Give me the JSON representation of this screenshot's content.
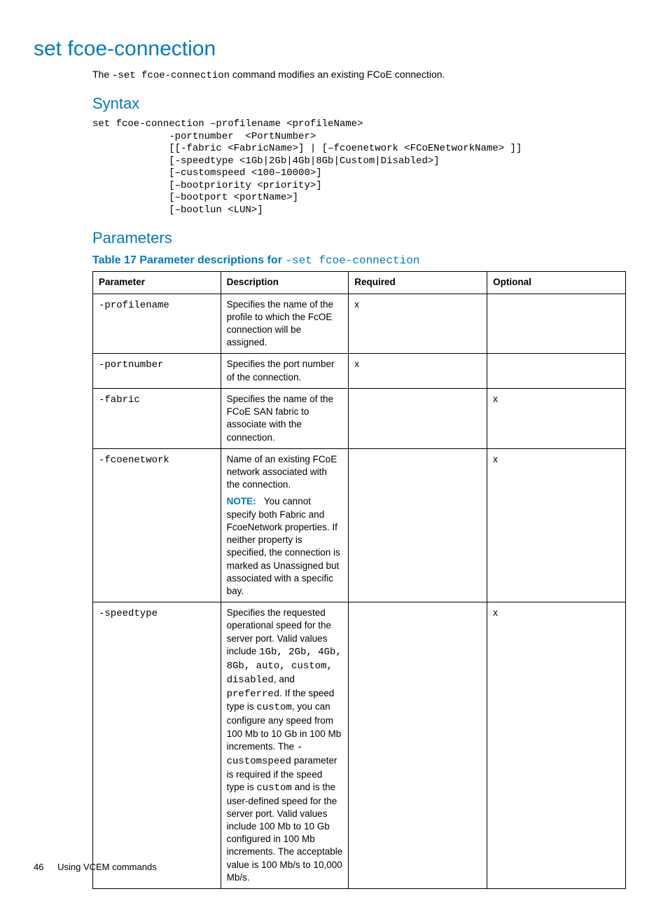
{
  "title": "set fcoe-connection",
  "intro_pre": "The ",
  "intro_code": "-set fcoe-connection",
  "intro_post": " command modifies an existing FCoE connection.",
  "syntax_heading": "Syntax",
  "syntax_block": "set fcoe-connection –profilename <profileName>\n             -portnumber  <PortNumber>\n             [[-fabric <FabricName>] | [–fcoenetwork <FCoENetworkName> ]]\n             [-speedtype <1Gb|2Gb|4Gb|8Gb|Custom|Disabled>]\n             [–customspeed <100–10000>]\n             [–bootpriority <priority>]\n             [–bootport <portName>]\n             [–bootlun <LUN>]",
  "parameters_heading": "Parameters",
  "table_caption_prefix": "Table 17 Parameter descriptions for ",
  "table_caption_code": "-set fcoe-connection",
  "headers": {
    "parameter": "Parameter",
    "description": "Description",
    "required": "Required",
    "optional": "Optional"
  },
  "rows": {
    "profilename": {
      "param": "-profilename",
      "desc": "Specifies the name of the profile to which the FcOE connection will be assigned.",
      "required": "x",
      "optional": ""
    },
    "portnumber": {
      "param": "-portnumber",
      "desc": "Specifies the port number of the connection.",
      "required": "x",
      "optional": ""
    },
    "fabric": {
      "param": "-fabric",
      "desc": "Specifies the name of the FCoE SAN fabric to associate with the connection.",
      "required": "",
      "optional": "x"
    },
    "fcoenetwork": {
      "param": "-fcoenetwork",
      "desc1": "Name of an existing FCoE network associated with the connection.",
      "note_label": "NOTE:",
      "note_text": "You cannot specify both Fabric and FcoeNetwork properties. If neither property is specified, the connection is marked as Unassigned but associated with a specific bay.",
      "required": "",
      "optional": "x"
    },
    "speedtype": {
      "param": "-speedtype",
      "d_a": "Specifies the requested operational speed for the server port. Valid values include ",
      "d_vals": "1Gb, 2Gb, 4Gb, 8Gb, auto, custom, disabled",
      "d_b": ", and ",
      "d_pref": "preferred",
      "d_c": ". If the speed type is ",
      "d_custom1": "custom",
      "d_d": ", you can configure any speed from 100 Mb to 10 Gb in 100 Mb increments. The ",
      "d_cs": "-customspeed",
      "d_e": " parameter is required if the speed type is ",
      "d_custom2": "custom",
      "d_f": " and is the user-defined speed for the server port. Valid values include 100 Mb to 10 Gb configured in 100 Mb increments. The acceptable value is 100 Mb/s to 10,000 Mb/s.",
      "required": "",
      "optional": "x"
    }
  },
  "footer": {
    "page": "46",
    "section": "Using VCEM commands"
  }
}
